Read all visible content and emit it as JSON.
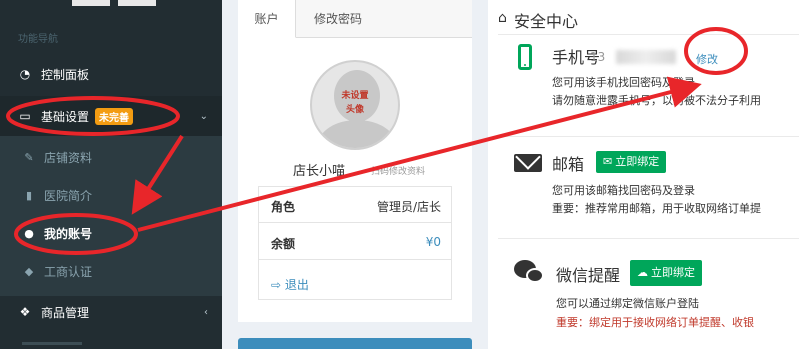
{
  "sidebar": {
    "section_title": "功能导航",
    "items": [
      {
        "label": "控制面板",
        "icon": "dashboard-icon"
      },
      {
        "label": "基础设置",
        "icon": "desktop-icon",
        "badge": "未完善"
      },
      {
        "label": "商品管理",
        "icon": "cubes-icon"
      }
    ],
    "sub_items": [
      {
        "label": "店铺资料",
        "icon": "edit-icon"
      },
      {
        "label": "医院简介",
        "icon": "bookmark-icon"
      },
      {
        "label": "我的账号",
        "icon": "user-icon"
      },
      {
        "label": "工商认证",
        "icon": "shield-icon"
      }
    ]
  },
  "account_panel": {
    "tabs": [
      "账户",
      "修改密码"
    ],
    "avatar_text_line1": "未设置",
    "avatar_text_line2": "头像",
    "shop_name": "店长小喵",
    "shop_name_sub": "扫码修改资料",
    "rows": [
      {
        "key": "角色",
        "value": "管理员/店长"
      },
      {
        "key": "余额",
        "value": "¥0"
      }
    ],
    "logout": "退出"
  },
  "security": {
    "title": "安全中心",
    "phone": {
      "title": "手机号",
      "number": "13",
      "modify": "修改",
      "desc1": "您可用该手机找回密码及登录",
      "desc2": "请勿随意泄露手机号，以防被不法分子利用"
    },
    "email": {
      "title": "邮箱",
      "button": "立即绑定",
      "desc1": "您可用该邮箱找回密码及登录",
      "desc2": "重要：推荐常用邮箱，用于收取网络订单提"
    },
    "wechat": {
      "title": "微信提醒",
      "button": "立即绑定",
      "desc1": "您可以通过绑定微信账户登陆",
      "desc2": "重要：绑定用于接收网络订单提醒、收银"
    }
  },
  "colors": {
    "sidebar_bg": "#222d32",
    "accent_green": "#00a65a",
    "link_blue": "#3c8dbc",
    "badge_orange": "#f39c12",
    "annotation_red": "#e8262a"
  }
}
